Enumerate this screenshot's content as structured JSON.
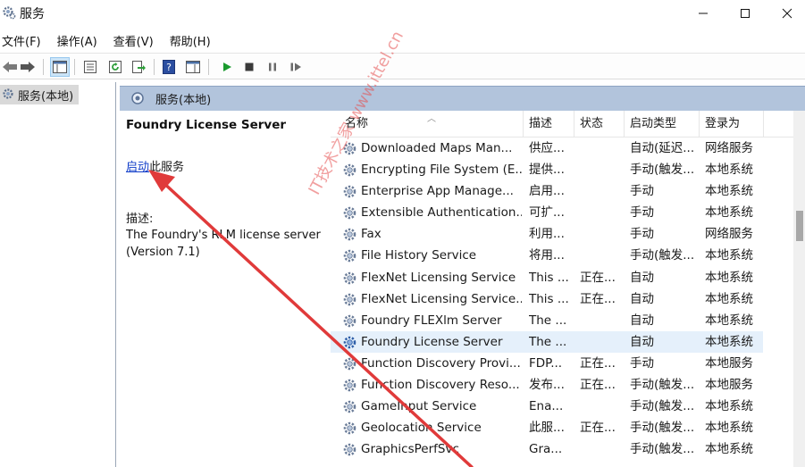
{
  "window": {
    "title": "服务"
  },
  "menu": [
    "文件(F)",
    "操作(A)",
    "查看(V)",
    "帮助(H)"
  ],
  "tree": {
    "item": "服务(本地)"
  },
  "pane": {
    "header": "服务(本地)"
  },
  "description": {
    "service_name": "Foundry License Server",
    "start_link": "启动",
    "start_suffix": "此服务",
    "desc_label": "描述:",
    "desc_text": "The Foundry's RLM license server (Version 7.1)"
  },
  "columns": {
    "name": "名称",
    "desc": "描述",
    "status": "状态",
    "start": "启动类型",
    "login": "登录为"
  },
  "rows": [
    {
      "name": "Downloaded Maps Man...",
      "desc": "供应...",
      "status": "",
      "start": "自动(延迟...",
      "login": "网络服务"
    },
    {
      "name": "Encrypting File System (E...",
      "desc": "提供...",
      "status": "",
      "start": "手动(触发...",
      "login": "本地系统"
    },
    {
      "name": "Enterprise App Manage...",
      "desc": "启用...",
      "status": "",
      "start": "手动",
      "login": "本地系统"
    },
    {
      "name": "Extensible Authentication...",
      "desc": "可扩...",
      "status": "",
      "start": "手动",
      "login": "本地系统"
    },
    {
      "name": "Fax",
      "desc": "利用...",
      "status": "",
      "start": "手动",
      "login": "网络服务"
    },
    {
      "name": "File History Service",
      "desc": "将用...",
      "status": "",
      "start": "手动(触发...",
      "login": "本地系统"
    },
    {
      "name": "FlexNet Licensing Service",
      "desc": "This ...",
      "status": "正在...",
      "start": "自动",
      "login": "本地系统"
    },
    {
      "name": "FlexNet Licensing Service...",
      "desc": "This ...",
      "status": "正在...",
      "start": "自动",
      "login": "本地系统"
    },
    {
      "name": "Foundry FLEXlm Server",
      "desc": "The ...",
      "status": "",
      "start": "自动",
      "login": "本地系统"
    },
    {
      "name": "Foundry License Server",
      "desc": "The ...",
      "status": "",
      "start": "自动",
      "login": "本地系统"
    },
    {
      "name": "Function Discovery Provi...",
      "desc": "FDP...",
      "status": "正在...",
      "start": "手动",
      "login": "本地服务"
    },
    {
      "name": "Function Discovery Reso...",
      "desc": "发布...",
      "status": "正在...",
      "start": "手动(触发...",
      "login": "本地服务"
    },
    {
      "name": "GameInput Service",
      "desc": "Ena...",
      "status": "",
      "start": "手动(触发...",
      "login": "本地系统"
    },
    {
      "name": "Geolocation Service",
      "desc": "此服...",
      "status": "正在...",
      "start": "手动(触发...",
      "login": "本地系统"
    },
    {
      "name": "GraphicsPerfSvc",
      "desc": "Gra...",
      "status": "",
      "start": "手动(触发...",
      "login": "本地系统"
    }
  ],
  "watermark": "IT技术之家 www.ittel.cn",
  "colors": {
    "header_band": "#b2c4dc",
    "selected_row": "#e5f0fb",
    "arrow": "#e03a3a",
    "link": "#0f3cc9"
  }
}
